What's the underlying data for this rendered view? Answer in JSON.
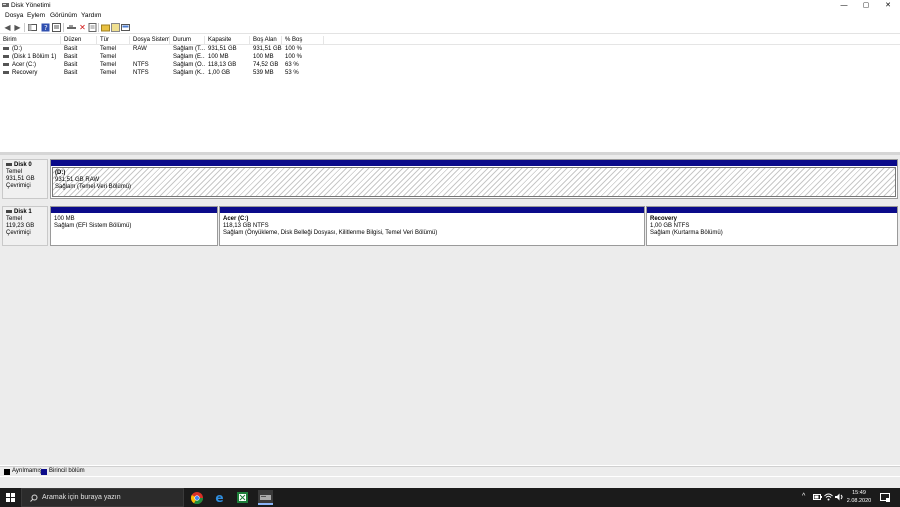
{
  "window": {
    "title": "Disk Yönetimi",
    "controls": {
      "minimize": "—",
      "maximize": "▢",
      "close": "✕"
    }
  },
  "menu": [
    "Dosya",
    "Eylem",
    "Görünüm",
    "Yardım"
  ],
  "toolbar": {
    "icons": [
      "back-icon",
      "forward-icon",
      "console-tree-icon",
      "help-icon",
      "list-icon",
      "connect-icon",
      "delete-icon",
      "properties-icon",
      "open-icon",
      "rescan-icon",
      "view-icon"
    ]
  },
  "volume_list": {
    "columns": [
      "Birim",
      "Düzen",
      "Tür",
      "Dosya Sistemi",
      "Durum",
      "Kapasite",
      "Boş Alan",
      "% Boş"
    ],
    "rows": [
      [
        "(D:)",
        "Basit",
        "Temel",
        "RAW",
        "Sağlam (T...",
        "931,51 GB",
        "931,51 GB",
        "100 %"
      ],
      [
        "(Disk 1 Bölüm 1)",
        "Basit",
        "Temel",
        "",
        "Sağlam (E...",
        "100 MB",
        "100 MB",
        "100 %"
      ],
      [
        "Acer (C:)",
        "Basit",
        "Temel",
        "NTFS",
        "Sağlam (Ö...",
        "118,13 GB",
        "74,52 GB",
        "63 %"
      ],
      [
        "Recovery",
        "Basit",
        "Temel",
        "NTFS",
        "Sağlam (K...",
        "1,00 GB",
        "539 MB",
        "53 %"
      ]
    ]
  },
  "disks": [
    {
      "name": "Disk 0",
      "type": "Temel",
      "size": "931,51 GB",
      "status": "Çevrimiçi",
      "partitions": [
        {
          "title": "(D:)",
          "size": "931,51 GB RAW",
          "status": "Sağlam (Temel Veri Bölümü)"
        }
      ]
    },
    {
      "name": "Disk 1",
      "type": "Temel",
      "size": "119,23 GB",
      "status": "Çevrimiçi",
      "partitions": [
        {
          "title": "",
          "size": "100 MB",
          "status": "Sağlam (EFI Sistem Bölümü)"
        },
        {
          "title": "Acer  (C:)",
          "size": "118,13 GB NTFS",
          "status": "Sağlam (Önyükleme, Disk Belleği Dosyası, Kilitlenme Bilgisi, Temel Veri Bölümü)"
        },
        {
          "title": "Recovery",
          "size": "1,00 GB NTFS",
          "status": "Sağlam (Kurtarma Bölümü)"
        }
      ]
    }
  ],
  "legend": [
    {
      "label": "Ayrılmamış",
      "color": "#000000"
    },
    {
      "label": "Birincil bölüm",
      "color": "#0b0b8a"
    }
  ],
  "taskbar": {
    "search_placeholder": "Aramak için buraya yazın",
    "apps": [
      "chrome-icon",
      "edge-icon",
      "spreadsheet-icon",
      "disk-management-icon"
    ],
    "time": "15:49",
    "date": "2.08.2020"
  }
}
